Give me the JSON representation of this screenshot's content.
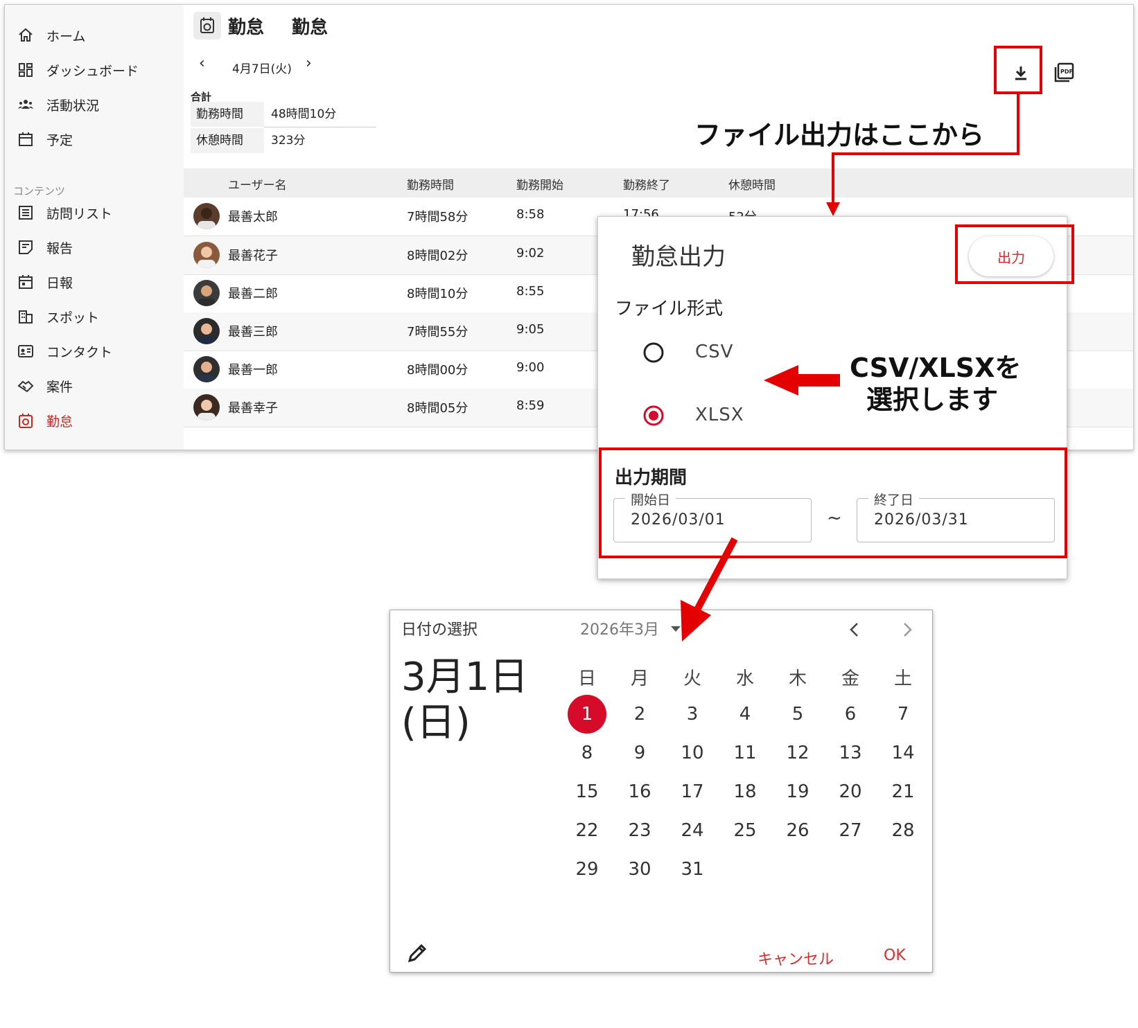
{
  "sidebar": {
    "items": [
      {
        "label": "ホーム",
        "icon": "home-icon"
      },
      {
        "label": "ダッシュボード",
        "icon": "dashboard-icon"
      },
      {
        "label": "活動状況",
        "icon": "people-icon"
      },
      {
        "label": "予定",
        "icon": "calendar-icon"
      }
    ],
    "section_label": "コンテンツ",
    "content_items": [
      {
        "label": "訪問リスト",
        "icon": "list-icon"
      },
      {
        "label": "報告",
        "icon": "report-icon"
      },
      {
        "label": "日報",
        "icon": "daily-report-icon"
      },
      {
        "label": "スポット",
        "icon": "building-icon"
      },
      {
        "label": "コンタクト",
        "icon": "contact-card-icon"
      },
      {
        "label": "案件",
        "icon": "handshake-icon"
      },
      {
        "label": "勤怠",
        "icon": "attendance-icon"
      }
    ],
    "active_color": "#c62828"
  },
  "header": {
    "title1": "勤怠",
    "title2": "勤怠",
    "date": "4月7日(火)",
    "prev": "‹",
    "next": "›"
  },
  "summary": {
    "label": "合計",
    "rows": [
      {
        "key": "勤務時間",
        "value": "48時間10分"
      },
      {
        "key": "休憩時間",
        "value": "323分"
      }
    ]
  },
  "table": {
    "headers": [
      "ユーザー名",
      "勤務時間",
      "勤務開始",
      "勤務終了",
      "休憩時間"
    ],
    "rows": [
      {
        "name": "最善太郎",
        "work": "7時間58分",
        "start": "8:58",
        "end": "17:56",
        "break": "52分"
      },
      {
        "name": "最善花子",
        "work": "8時間02分",
        "start": "9:02"
      },
      {
        "name": "最善二郎",
        "work": "8時間10分",
        "start": "8:55"
      },
      {
        "name": "最善三郎",
        "work": "7時間55分",
        "start": "9:05"
      },
      {
        "name": "最善一郎",
        "work": "8時間00分",
        "start": "9:00"
      },
      {
        "name": "最善幸子",
        "work": "8時間05分",
        "start": "8:59"
      }
    ]
  },
  "dialog": {
    "title": "勤怠出力",
    "output_button": "出力",
    "file_format_label": "ファイル形式",
    "options": [
      "CSV",
      "XLSX"
    ],
    "selected": "XLSX",
    "period_label": "出力期間",
    "start_label": "開始日",
    "start_value": "2026/03/01",
    "tilde": "~",
    "end_label": "終了日",
    "end_value": "2026/03/31",
    "accent": "#d60b2a"
  },
  "picker": {
    "title": "日付の選択",
    "month": "2026年3月",
    "selected_line1": "3月1日",
    "selected_line2": "(日)",
    "weekdays": [
      "日",
      "月",
      "火",
      "水",
      "木",
      "金",
      "土"
    ],
    "days": [
      "1",
      "2",
      "3",
      "4",
      "5",
      "6",
      "7",
      "8",
      "9",
      "10",
      "11",
      "12",
      "13",
      "14",
      "15",
      "16",
      "17",
      "18",
      "19",
      "20",
      "21",
      "22",
      "23",
      "24",
      "25",
      "26",
      "27",
      "28",
      "29",
      "30",
      "31"
    ],
    "selected_day": "1",
    "cancel": "キャンセル",
    "ok": "OK"
  },
  "annotations": {
    "file_output": "ファイル出力はここから",
    "select_line1": "CSV/XLSXを",
    "select_line2": "選択します",
    "color": "#e40000"
  }
}
